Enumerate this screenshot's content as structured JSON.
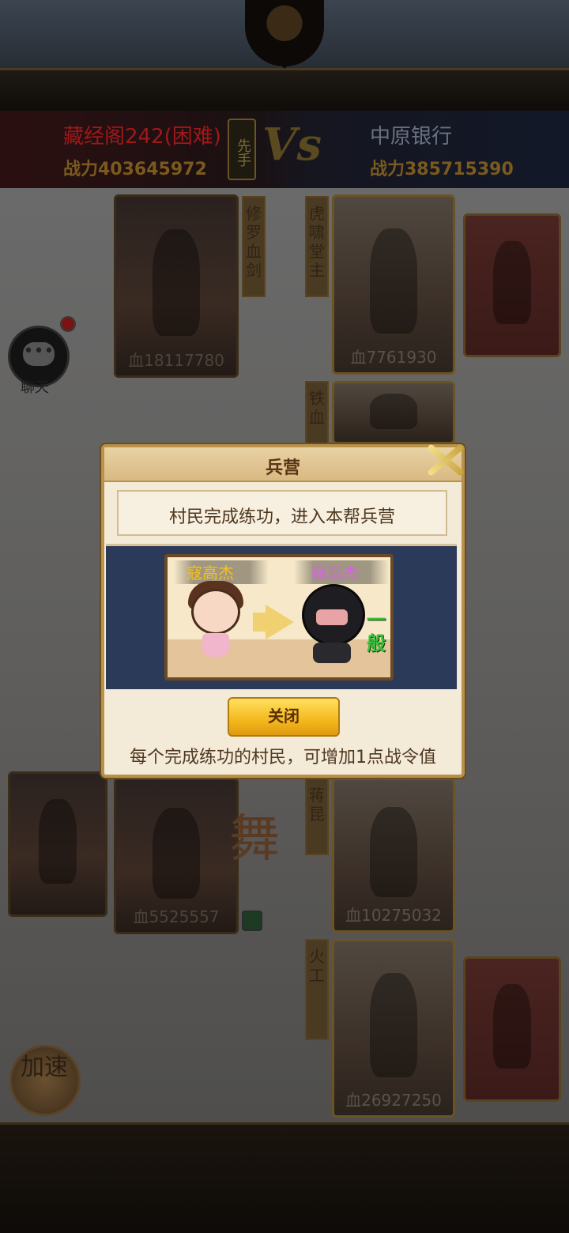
{
  "battle": {
    "left_team": {
      "name": "藏经阁242(困难)",
      "power": "战力403645972"
    },
    "right_team": {
      "name": "中原银行",
      "power": "战力385715390"
    },
    "first_move": "先手",
    "vs": "Vs"
  },
  "units": {
    "left": [
      {
        "hp": "血18117780",
        "plate": "修罗血剑"
      },
      {
        "hp": "血5525557"
      }
    ],
    "right": [
      {
        "hp": "血7761930",
        "plate": "虎啸堂主"
      },
      {
        "plate": "铁血"
      },
      {
        "hp": "血10275032",
        "plate": "蒋昆"
      },
      {
        "hp": "血26927250",
        "plate": "火工"
      }
    ],
    "background_glyph": "舞"
  },
  "chat": {
    "label": "聊天",
    "icon": "chat-bubble-icon"
  },
  "speed": {
    "label": "加速"
  },
  "dialog": {
    "title": "兵营",
    "subtitle": "村民完成练功，进入本帮兵营",
    "from_name": "寇高杰",
    "to_name": "寇高杰",
    "rank": "一般",
    "close_label": "关闭",
    "footer": "每个完成练功的村民，可增加1点战令值"
  },
  "colors": {
    "dialog_bg": "#f4ead8",
    "button_gold": "#f4b81c",
    "name_normal": "#f4c020",
    "name_purple": "#d660e8",
    "rank_green": "#3cc23c"
  }
}
